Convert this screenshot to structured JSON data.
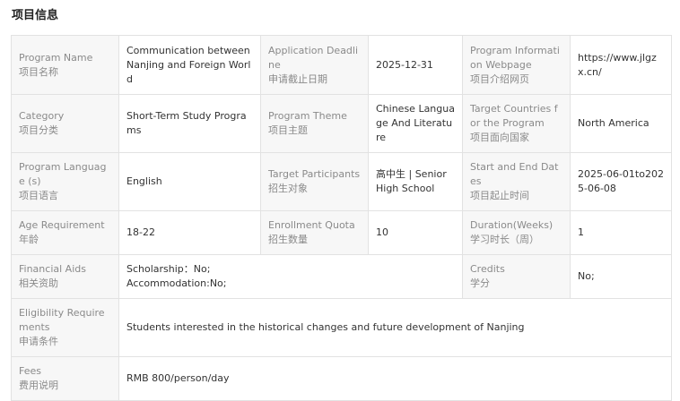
{
  "section_title": "项目信息",
  "rows": [
    {
      "cells": [
        {
          "en": "Program Name",
          "zh": "项目名称",
          "value": "Communication between Nanjing and Foreign World"
        },
        {
          "en": "Application Deadline",
          "zh": "申请截止日期",
          "value": "2025-12-31"
        },
        {
          "en": "Program Information Webpage",
          "zh": "项目介绍网页",
          "value": "https://www.jlgzx.cn/"
        }
      ]
    },
    {
      "cells": [
        {
          "en": "Category",
          "zh": "项目分类",
          "value": "Short-Term Study Programs"
        },
        {
          "en": "Program Theme",
          "zh": "项目主题",
          "value": "Chinese Language And Literature"
        },
        {
          "en": "Target Countries for the Program",
          "zh": "项目面向国家",
          "value": "North America"
        }
      ]
    },
    {
      "cells": [
        {
          "en": "Program Language (s)",
          "zh": "项目语言",
          "value": "English"
        },
        {
          "en": "Target Participants",
          "zh": "招生对象",
          "value": "高中生 | Senior High School"
        },
        {
          "en": "Start and End Dates",
          "zh": "项目起止时间",
          "value": "2025-06-01to2025-06-08"
        }
      ]
    },
    {
      "cells": [
        {
          "en": "Age Requirement",
          "zh": "年龄",
          "value": "18-22"
        },
        {
          "en": "Enrollment Quota",
          "zh": "招生数量",
          "value": "10"
        },
        {
          "en": "Duration(Weeks)",
          "zh": "学习时长（周）",
          "value": "1"
        }
      ]
    },
    {
      "financial": {
        "en": "Financial Aids",
        "zh": "相关资助",
        "line1": "Scholarship：No;",
        "line2": "Accommodation:No;"
      },
      "credits": {
        "en": "Credits",
        "zh": "学分",
        "value": "No;"
      }
    },
    {
      "wide": {
        "en": "Eligibility Requirements",
        "zh": "申请条件",
        "value": "Students interested in the historical changes and future development of Nanjing"
      }
    },
    {
      "wide": {
        "en": "Fees",
        "zh": "费用说明",
        "value": "RMB 800/person/day"
      }
    }
  ]
}
